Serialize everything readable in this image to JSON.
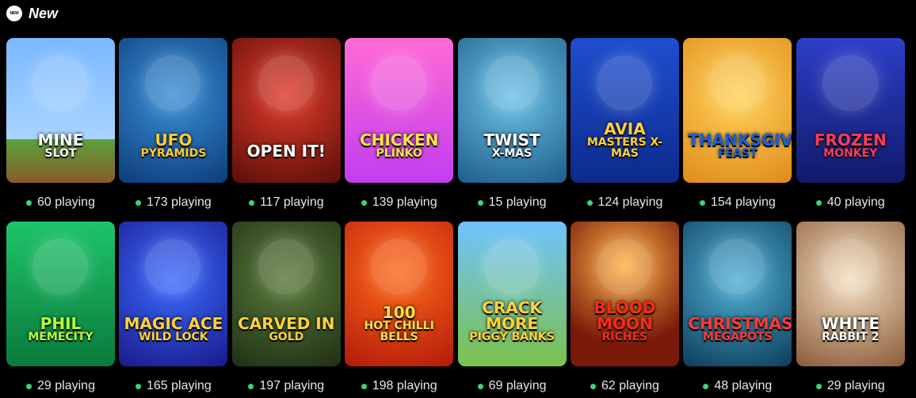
{
  "section": {
    "title": "New",
    "badge_label": "NEW"
  },
  "games": [
    {
      "title_line1": "MINE",
      "title_line2": "SLOT",
      "players": "60 playing",
      "bg": "linear-gradient(#7ab8ff,#a8d4ff 70%,#5aa33a 70%,#8b5a2b)",
      "title_color": "#ffffff",
      "icon": "pixel-chicken-icon"
    },
    {
      "title_line1": "UFO",
      "title_line2": "PYRAMIDS",
      "players": "173 playing",
      "bg": "radial-gradient(circle at 50% 40%,#3a8fd6,#0c3d7a)",
      "title_color": "#ffcc33",
      "icon": "alien-pharaoh-icon"
    },
    {
      "title_line1": "OPEN IT!",
      "title_line2": "",
      "players": "117 playing",
      "bg": "radial-gradient(circle at 50% 40%,#e03a2a,#5a0f08)",
      "title_color": "#ffffff",
      "icon": "gift-box-icon"
    },
    {
      "title_line1": "CHICKEN",
      "title_line2": "PLINKO",
      "players": "139 playing",
      "bg": "linear-gradient(#ff6ad5,#c23ef0)",
      "title_color": "#ffe14a",
      "icon": "chicken-icon"
    },
    {
      "title_line1": "TWIST",
      "title_line2": "X-MAS",
      "players": "15 playing",
      "bg": "radial-gradient(circle at 50% 40%,#6fc2e8,#1b5d8a)",
      "title_color": "#ffffff",
      "icon": "roulette-wheel-icon"
    },
    {
      "title_line1": "AVIA",
      "title_line2": "MASTERS X-MAS",
      "players": "124 playing",
      "bg": "linear-gradient(#1e4fd0,#0d2a8c)",
      "title_color": "#ffd23a",
      "icon": "santa-sleigh-icon"
    },
    {
      "title_line1": "Thanksgiving",
      "title_line2": "Feast",
      "players": "154 playing",
      "bg": "radial-gradient(circle at 50% 40%,#ffd35a,#e08a1a)",
      "title_color": "#1d5fd1",
      "icon": "roast-turkey-icon"
    },
    {
      "title_line1": "FROZEN",
      "title_line2": "MONKEY",
      "players": "40 playing",
      "bg": "linear-gradient(#2d3fc9,#0f1a6a)",
      "title_color": "#ff3a5a",
      "icon": "monkey-icon"
    },
    {
      "title_line1": "PHIL",
      "title_line2": "MEMECITY",
      "players": "29 playing",
      "bg": "linear-gradient(#1ec46a,#0a7a3c)",
      "title_color": "#b6ff3a",
      "icon": "snake-icon"
    },
    {
      "title_line1": "MAGIC ACE",
      "title_line2": "Wild Lock",
      "players": "165 playing",
      "bg": "radial-gradient(circle at 50% 40%,#3a6bff,#1a1a8a)",
      "title_color": "#ffd23a",
      "icon": "jester-hat-icon"
    },
    {
      "title_line1": "CARVED IN",
      "title_line2": "GOLD",
      "players": "197 playing",
      "bg": "radial-gradient(circle at 50% 40%,#5a7a3a,#1f3015)",
      "title_color": "#ffd23a",
      "icon": "aztec-mask-icon"
    },
    {
      "title_line1": "100",
      "title_line2": "Hot Chilli Bells",
      "players": "198 playing",
      "bg": "radial-gradient(circle at 50% 35%,#ff6a1a,#b31a0a)",
      "title_color": "#ffe14a",
      "icon": "bell-icon"
    },
    {
      "title_line1": "CRACK MORE",
      "title_line2": "PIGGY BANKS",
      "players": "69 playing",
      "bg": "linear-gradient(#6fc3ff,#7cc24a)",
      "title_color": "#ffd23a",
      "icon": "pig-icon"
    },
    {
      "title_line1": "BLOOD MOON",
      "title_line2": "RICHES",
      "players": "62 playing",
      "bg": "radial-gradient(circle at 50% 30%,#ffb347,#7a1a0a 70%)",
      "title_color": "#ff2a1a",
      "icon": "vampire-icon"
    },
    {
      "title_line1": "CHRISTMAS",
      "title_line2": "MEGAPOTS",
      "players": "48 playing",
      "bg": "radial-gradient(circle at 50% 40%,#4fb0d6,#0d3d5a)",
      "title_color": "#ff3a3a",
      "icon": "christmas-tree-icon"
    },
    {
      "title_line1": "WHITE",
      "title_line2": "RABBIT 2",
      "players": "29 playing",
      "bg": "radial-gradient(circle at 50% 40%,#f4e0c0,#8a5a3a)",
      "title_color": "#ffffff",
      "icon": "queen-icon"
    }
  ]
}
